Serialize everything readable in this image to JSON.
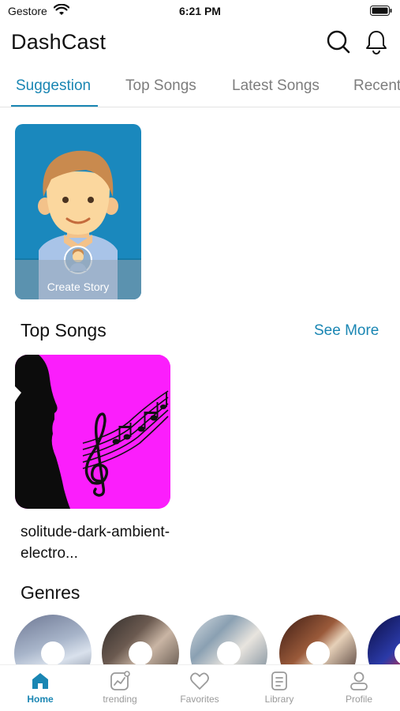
{
  "status_bar": {
    "carrier": "Gestore",
    "time": "6:21 PM"
  },
  "header": {
    "title": "DashCast",
    "search_icon": "search-icon",
    "bell_icon": "bell-icon"
  },
  "tabs": [
    {
      "label": "Suggestion",
      "active": true
    },
    {
      "label": "Top Songs",
      "active": false
    },
    {
      "label": "Latest Songs",
      "active": false
    },
    {
      "label": "Recent",
      "active": false
    }
  ],
  "story": {
    "label": "Create Story"
  },
  "top_songs": {
    "title": "Top Songs",
    "see_more": "See More",
    "items": [
      {
        "title": "solitude-dark-ambient-electro..."
      }
    ]
  },
  "genres": {
    "title": "Genres",
    "count": 5
  },
  "bottom_nav": [
    {
      "label": "Home",
      "icon": "home-icon",
      "active": true
    },
    {
      "label": "trending",
      "icon": "trending-icon",
      "active": false
    },
    {
      "label": "Favorites",
      "icon": "heart-icon",
      "active": false
    },
    {
      "label": "Library",
      "icon": "library-icon",
      "active": false
    },
    {
      "label": "Profile",
      "icon": "profile-icon",
      "active": false
    }
  ],
  "colors": {
    "accent": "#1a86b3",
    "story_bg": "#1a88bd",
    "song_art_bg": "#fb1efc",
    "inactive": "#9a9a9a"
  }
}
